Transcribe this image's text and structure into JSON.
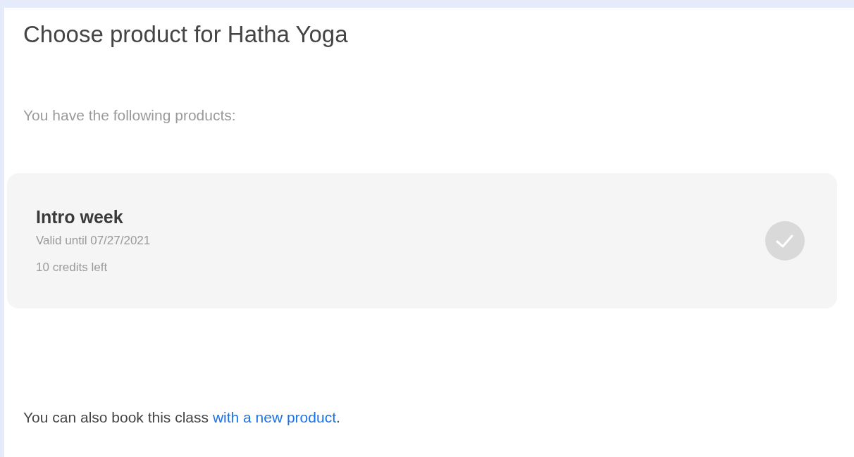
{
  "title": "Choose product for Hatha Yoga",
  "subtitle": "You have the following products:",
  "products": [
    {
      "name": "Intro week",
      "valid_until": "Valid until 07/27/2021",
      "credits": "10 credits left",
      "selected": false
    }
  ],
  "footer": {
    "text_before": "You can also book this class ",
    "link": "with a new product",
    "text_after": "."
  }
}
